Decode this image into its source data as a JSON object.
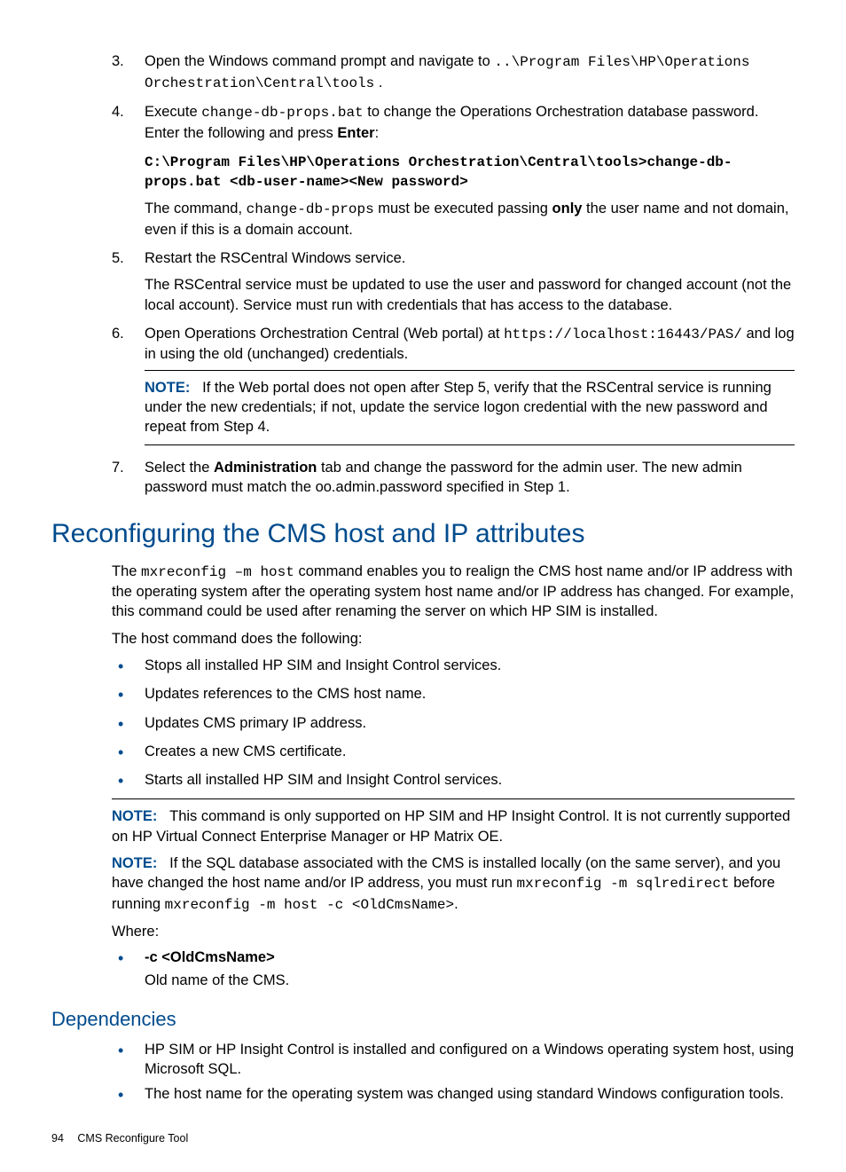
{
  "steps": {
    "s3": {
      "num": "3.",
      "text_a": "Open the Windows command prompt and navigate to ",
      "code_a": "..\\Program Files\\HP\\Operations Orchestration\\Central\\tools",
      "text_b": " ."
    },
    "s4": {
      "num": "4.",
      "text_a": "Execute ",
      "code_a": "change-db-props.bat",
      "text_b": " to change the Operations Orchestration database password. Enter the following and press ",
      "bold_a": "Enter",
      "text_c": ":",
      "cmd": "C:\\Program Files\\HP\\Operations Orchestration\\Central\\tools>change-db-props.bat <db-user-name><New password>",
      "p2_a": "The command, ",
      "p2_code": "change-db-props",
      "p2_b": " must be executed passing ",
      "p2_bold": "only",
      "p2_c": " the user name and not domain, even if this is a domain account."
    },
    "s5": {
      "num": "5.",
      "text_a": "Restart the RSCentral Windows service.",
      "p2": "The RSCentral service must be updated to use the user and password for changed account (not the local account). Service must run with credentials that has access to the database."
    },
    "s6": {
      "num": "6.",
      "text_a": "Open Operations Orchestration Central (Web portal) at ",
      "code_a": "https://localhost:16443/PAS/",
      "text_b": " and log in using the old (unchanged) credentials.",
      "note_label": "NOTE:",
      "note_text": "If the Web portal does not open after Step 5, verify that the RSCentral service is running under the new credentials; if not, update the service logon credential with the new password and repeat from Step 4."
    },
    "s7": {
      "num": "7.",
      "text_a": "Select the ",
      "bold_a": "Administration",
      "text_b": " tab and change the password for the admin user. The new admin password must match the oo.admin.password specified in Step 1."
    }
  },
  "section1": {
    "title": "Reconfiguring the CMS host and IP attributes",
    "p1_a": "The ",
    "p1_code": "mxreconfig –m host",
    "p1_b": " command enables you to realign the CMS host name and/or IP address with the operating system after the operating system host name and/or IP address has changed. For example, this command could be used after renaming the server on which HP SIM is installed.",
    "p2": "The host command does the following:",
    "bullets": [
      "Stops all installed HP SIM and Insight Control services.",
      "Updates references to the CMS host name.",
      "Updates CMS primary IP address.",
      "Creates a new CMS certificate.",
      "Starts all installed HP SIM and Insight Control services."
    ],
    "note1_label": "NOTE:",
    "note1_text": "This command is only supported on HP SIM and HP Insight Control. It is not currently supported on HP Virtual Connect Enterprise Manager or HP Matrix OE.",
    "note2_label": "NOTE:",
    "note2_a": "If the SQL database associated with the CMS is installed locally (on the same server), and you have changed the host name and/or IP address, you must run ",
    "note2_code1": "mxreconfig -m sqlredirect",
    "note2_b": " before running ",
    "note2_code2": "mxreconfig -m host -c <OldCmsName>",
    "note2_c": ".",
    "where": "Where:",
    "opt_name": "-c <OldCmsName>",
    "opt_desc": "Old name of the CMS."
  },
  "section2": {
    "title": "Dependencies",
    "bullets": [
      "HP SIM or HP Insight Control is installed and configured on a Windows operating system host, using Microsoft SQL.",
      "The host name for the operating system was changed using standard Windows configuration tools."
    ]
  },
  "footer": {
    "page": "94",
    "title": "CMS Reconfigure Tool"
  }
}
